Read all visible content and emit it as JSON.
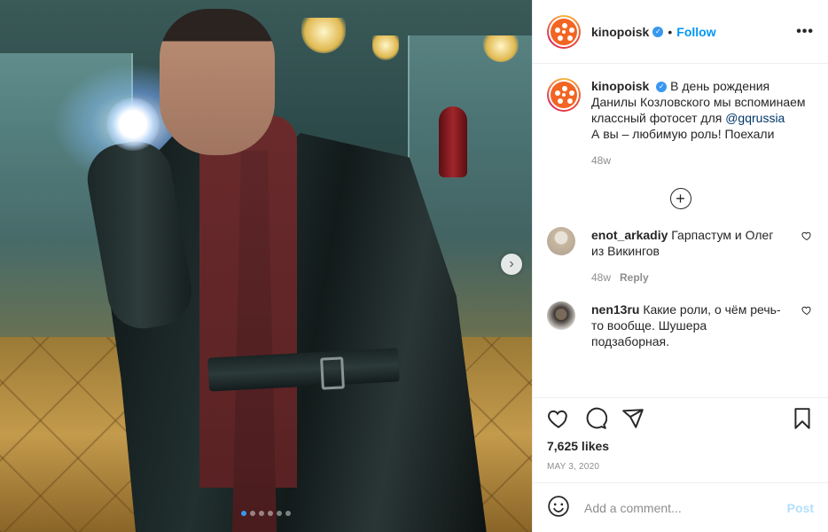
{
  "account": {
    "username": "kinopoisk",
    "follow_label": "Follow",
    "more_label": "•••",
    "verified_mark": "✓"
  },
  "caption": {
    "username": "kinopoisk",
    "text_before_mention": "В день рождения Данилы Козловского мы вспоминаем классный фотосет для ",
    "mention": "@gqrussia",
    "text_after_mention": "А вы – любимую роль! Поехали",
    "time": "48w"
  },
  "load_more_symbol": "+",
  "comments": [
    {
      "username": "enot_arkadiy",
      "text": "Гарпастум и Олег из Викингов",
      "time": "48w",
      "reply_label": "Reply"
    },
    {
      "username": "nen13ru",
      "text": "Какие роли, о чём речь-то вообще. Шушера подзаборная."
    }
  ],
  "likes": "7,625 likes",
  "date": "MAY 3, 2020",
  "add_comment": {
    "placeholder": "Add a comment...",
    "post_label": "Post"
  },
  "carousel": {
    "slide_count": 6,
    "active_index": 0,
    "next_symbol": "›"
  },
  "colors": {
    "brand_orange": "#f26522",
    "link_blue": "#0095f6",
    "mention_blue": "#00376b",
    "muted_gray": "#8e8e8e"
  },
  "icons": [
    "heart-icon",
    "comment-icon",
    "share-icon",
    "bookmark-icon",
    "emoji-icon",
    "verified-icon",
    "more-options-icon",
    "next-arrow-icon",
    "load-more-icon"
  ]
}
